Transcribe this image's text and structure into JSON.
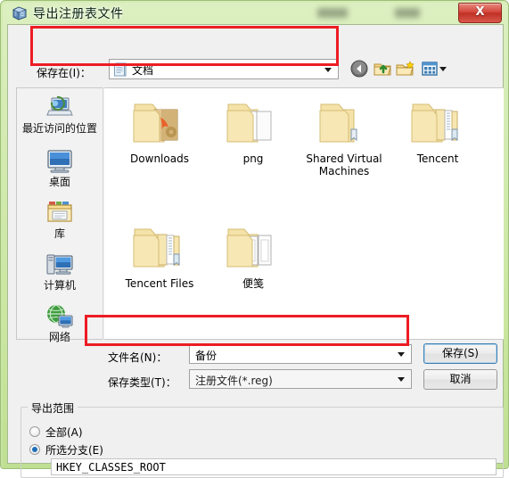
{
  "window": {
    "title": "导出注册表文件",
    "title_icon": "registry-editor-icon",
    "close_label": "X",
    "frame_color": "#cfe8aa",
    "accent_red": "#ed1c24"
  },
  "toolbar": {
    "lookin_label": "保存在(I)：",
    "lookin_value": "文档",
    "lookin_icon": "documents-folder-icon",
    "buttons": [
      {
        "name": "back-button",
        "icon": "back-arrow-icon",
        "label": "后退"
      },
      {
        "name": "up-button",
        "icon": "up-folder-icon",
        "label": "向上一级"
      },
      {
        "name": "new-folder-button",
        "icon": "new-folder-icon",
        "label": "新建文件夹"
      },
      {
        "name": "views-button",
        "icon": "views-icon",
        "label": "视图"
      }
    ]
  },
  "places": {
    "items": [
      {
        "label": "最近访问的位置",
        "icon": "recent-places-icon"
      },
      {
        "label": "桌面",
        "icon": "desktop-icon"
      },
      {
        "label": "库",
        "icon": "libraries-icon"
      },
      {
        "label": "计算机",
        "icon": "computer-icon"
      },
      {
        "label": "网络",
        "icon": "network-icon"
      }
    ]
  },
  "filelist": {
    "items": [
      {
        "label": "Downloads",
        "icon": "folder-downloads-icon"
      },
      {
        "label": "png",
        "icon": "folder-docs-icon"
      },
      {
        "label": "Shared Virtual Machines",
        "icon": "folder-plain-icon"
      },
      {
        "label": "Tencent",
        "icon": "folder-multi-icon"
      },
      {
        "label": "Tencent Files",
        "icon": "folder-multi-icon"
      },
      {
        "label": "便笺",
        "icon": "folder-notes-icon"
      }
    ]
  },
  "form": {
    "filename_label": "文件名(N)：",
    "filename_value": "备份",
    "filetype_label": "保存类型(T)：",
    "filetype_value": "注册文件(*.reg)",
    "save_label": "保存(S)",
    "cancel_label": "取消"
  },
  "export_range": {
    "legend": "导出范围",
    "option_all": "全部(A)",
    "option_selected": "所选分支(E)",
    "selected_option": "所选分支(E)",
    "branch_value": "HKEY_CLASSES_ROOT"
  }
}
